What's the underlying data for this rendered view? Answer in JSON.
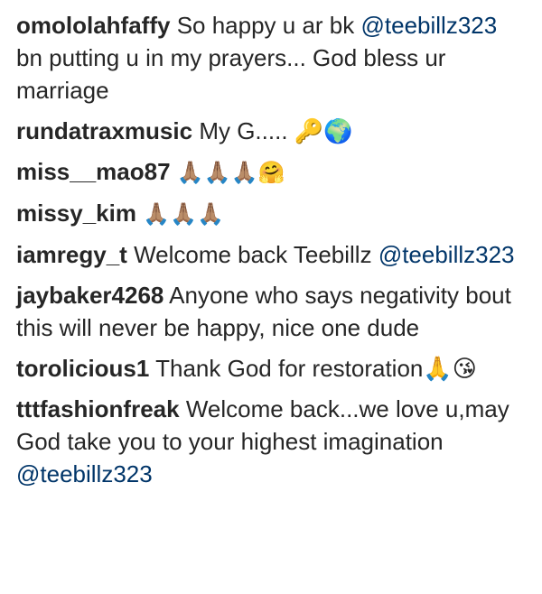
{
  "comments": [
    {
      "username": "omololahfaffy",
      "text_before": "So happy u ar bk",
      "mention": "@teebillz323",
      "text_after": "bn putting u in my prayers... God bless ur marriage"
    },
    {
      "username": "rundatraxmusic",
      "text": "My G..... 🔑🌍"
    },
    {
      "username": "miss__mao87",
      "text": "🙏🏽🙏🏽🙏🏽🤗"
    },
    {
      "username": "missy_kim",
      "text": "🙏🏽🙏🏽🙏🏽"
    },
    {
      "username": "iamregy_t",
      "text": "Welcome back Teebillz",
      "mention": "@teebillz323"
    },
    {
      "username": "jaybaker4268",
      "text": "Anyone who says negativity bout this will never be happy, nice one dude"
    },
    {
      "username": "torolicious1",
      "text": "Thank God for restoration🙏😘"
    },
    {
      "username": "tttfashionfreak",
      "text": "Welcome back...we love u,may God take you to your highest imagination",
      "mention": "@teebillz323"
    }
  ],
  "colors": {
    "username": "#262626",
    "text": "#262626",
    "mention": "#003569",
    "background": "#ffffff"
  }
}
